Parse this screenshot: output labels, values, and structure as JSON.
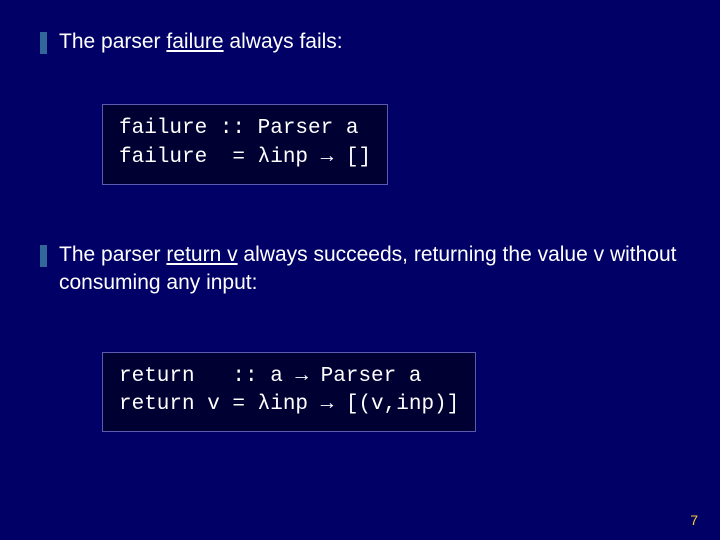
{
  "bullet1": {
    "pre": "The parser ",
    "underlined": "failure",
    "post": " always fails:"
  },
  "code1": {
    "line1": "failure :: Parser a",
    "line2": "failure  = λinp → []"
  },
  "bullet2": {
    "pre": "The parser ",
    "underlined": "return v",
    "post": " always succeeds, returning the value v without consuming any input:"
  },
  "code2": {
    "line1": "return   :: a → Parser a",
    "line2": "return v = λinp → [(v,inp)]"
  },
  "pagenum": "7"
}
